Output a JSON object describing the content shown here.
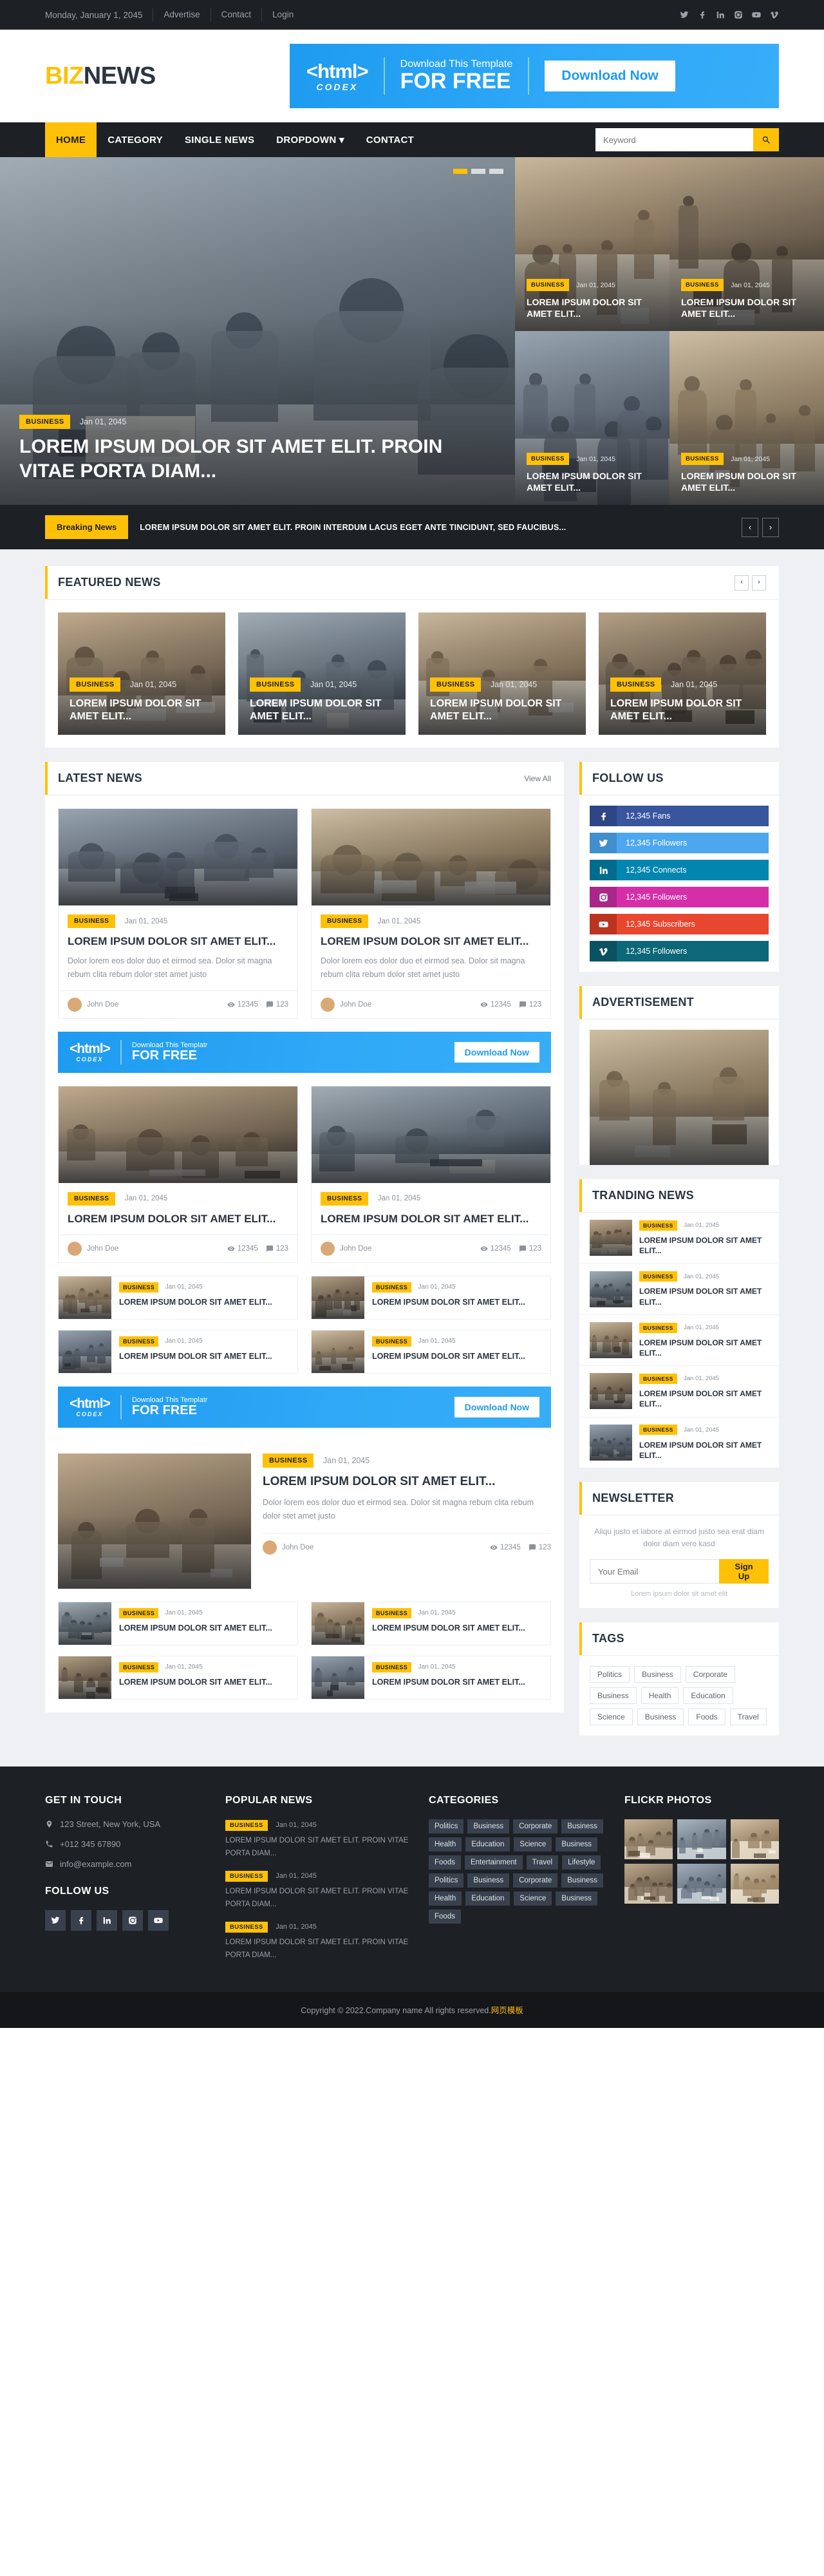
{
  "topbar": {
    "date": "Monday, January 1, 2045",
    "links": [
      "Advertise",
      "Contact",
      "Login"
    ],
    "socials": [
      "twitter-icon",
      "facebook-icon",
      "linkedin-icon",
      "instagram-icon",
      "youtube-icon",
      "vimeo-icon"
    ]
  },
  "header": {
    "logo_first": "BIZ",
    "logo_second": "NEWS",
    "ad": {
      "tag": "<html>",
      "codex": "CODEX",
      "line1": "Download This Template",
      "line2": "FOR FREE",
      "button": "Download Now"
    }
  },
  "nav": {
    "items": [
      {
        "label": "HOME",
        "active": true
      },
      {
        "label": "CATEGORY",
        "active": false
      },
      {
        "label": "SINGLE NEWS",
        "active": false
      },
      {
        "label": "DROPDOWN ▾",
        "active": false
      },
      {
        "label": "CONTACT",
        "active": false
      }
    ],
    "search_placeholder": "Keyword"
  },
  "hero": {
    "main": {
      "category": "BUSINESS",
      "date": "Jan 01, 2045",
      "title": "LOREM IPSUM DOLOR SIT AMET ELIT. PROIN VITAE PORTA DIAM..."
    },
    "side": [
      {
        "category": "BUSINESS",
        "date": "Jan 01, 2045",
        "title": "LOREM IPSUM DOLOR SIT AMET ELIT..."
      },
      {
        "category": "BUSINESS",
        "date": "Jan 01, 2045",
        "title": "LOREM IPSUM DOLOR SIT AMET ELIT..."
      },
      {
        "category": "BUSINESS",
        "date": "Jan 01, 2045",
        "title": "LOREM IPSUM DOLOR SIT AMET ELIT..."
      },
      {
        "category": "BUSINESS",
        "date": "Jan 01, 2045",
        "title": "LOREM IPSUM DOLOR SIT AMET ELIT..."
      }
    ]
  },
  "breaking": {
    "label": "Breaking News",
    "text": "LOREM IPSUM DOLOR SIT AMET ELIT. PROIN INTERDUM LACUS EGET ANTE TINCIDUNT, SED FAUCIBUS...",
    "prev": "‹",
    "next": "›"
  },
  "featured": {
    "title": "FEATURED NEWS",
    "prev": "‹",
    "next": "›",
    "items": [
      {
        "category": "BUSINESS",
        "date": "Jan 01, 2045",
        "title": "LOREM IPSUM DOLOR SIT AMET ELIT..."
      },
      {
        "category": "BUSINESS",
        "date": "Jan 01, 2045",
        "title": "LOREM IPSUM DOLOR SIT AMET ELIT..."
      },
      {
        "category": "BUSINESS",
        "date": "Jan 01, 2045",
        "title": "LOREM IPSUM DOLOR SIT AMET ELIT..."
      },
      {
        "category": "BUSINESS",
        "date": "Jan 01, 2045",
        "title": "LOREM IPSUM DOLOR SIT AMET ELIT..."
      }
    ]
  },
  "latest": {
    "title": "LATEST NEWS",
    "view_all": "View All",
    "cards": [
      {
        "category": "BUSINESS",
        "date": "Jan 01, 2045",
        "title": "LOREM IPSUM DOLOR SIT AMET ELIT...",
        "excerpt": "Dolor lorem eos dolor duo et eirmod sea. Dolor sit magna rebum clita rebum dolor stet amet justo",
        "author": "John Doe",
        "views": "12345",
        "comments": "123"
      },
      {
        "category": "BUSINESS",
        "date": "Jan 01, 2045",
        "title": "LOREM IPSUM DOLOR SIT AMET ELIT...",
        "excerpt": "Dolor lorem eos dolor duo et eirmod sea. Dolor sit magna rebum clita rebum dolor stet amet justo",
        "author": "John Doe",
        "views": "12345",
        "comments": "123"
      },
      {
        "category": "BUSINESS",
        "date": "Jan 01, 2045",
        "title": "LOREM IPSUM DOLOR SIT AMET ELIT...",
        "excerpt": "",
        "author": "John Doe",
        "views": "12345",
        "comments": "123"
      },
      {
        "category": "BUSINESS",
        "date": "Jan 01, 2045",
        "title": "LOREM IPSUM DOLOR SIT AMET ELIT...",
        "excerpt": "",
        "author": "John Doe",
        "views": "12345",
        "comments": "123"
      }
    ],
    "small_items": [
      {
        "category": "BUSINESS",
        "date": "Jan 01, 2045",
        "title": "LOREM IPSUM DOLOR SIT AMET ELIT..."
      },
      {
        "category": "BUSINESS",
        "date": "Jan 01, 2045",
        "title": "LOREM IPSUM DOLOR SIT AMET ELIT..."
      },
      {
        "category": "BUSINESS",
        "date": "Jan 01, 2045",
        "title": "LOREM IPSUM DOLOR SIT AMET ELIT..."
      },
      {
        "category": "BUSINESS",
        "date": "Jan 01, 2045",
        "title": "LOREM IPSUM DOLOR SIT AMET ELIT..."
      }
    ],
    "big_feature": {
      "category": "BUSINESS",
      "date": "Jan 01, 2045",
      "title": "LOREM IPSUM DOLOR SIT AMET ELIT...",
      "excerpt": "Dolor lorem eos dolor duo et eirmod sea. Dolor sit magna rebum clita rebum dolor stet amet justo",
      "author": "John Doe",
      "views": "12345",
      "comments": "123"
    },
    "small_items_2": [
      {
        "category": "BUSINESS",
        "date": "Jan 01, 2045",
        "title": "LOREM IPSUM DOLOR SIT AMET ELIT..."
      },
      {
        "category": "BUSINESS",
        "date": "Jan 01, 2045",
        "title": "LOREM IPSUM DOLOR SIT AMET ELIT..."
      },
      {
        "category": "BUSINESS",
        "date": "Jan 01, 2045",
        "title": "LOREM IPSUM DOLOR SIT AMET ELIT..."
      },
      {
        "category": "BUSINESS",
        "date": "Jan 01, 2045",
        "title": "LOREM IPSUM DOLOR SIT AMET ELIT..."
      }
    ],
    "inner_ad": {
      "tag": "<html>",
      "codex": "CODEX",
      "line1": "Download This Templatr",
      "line2": "FOR FREE",
      "button": "Download Now"
    }
  },
  "sidebar": {
    "follow_us": {
      "title": "FOLLOW US",
      "items": [
        {
          "icon": "facebook-icon",
          "label": "12,345 Fans",
          "color": "#39559E",
          "icon_bg": "#2F4686"
        },
        {
          "icon": "twitter-icon",
          "label": "12,345 Followers",
          "color": "#4DA7EE",
          "icon_bg": "#418FCC"
        },
        {
          "icon": "linkedin-icon",
          "label": "12,345 Connects",
          "color": "#0285AE",
          "icon_bg": "#016C8D"
        },
        {
          "icon": "instagram-icon",
          "label": "12,345 Followers",
          "color": "#D62EA8",
          "icon_bg": "#A92789"
        },
        {
          "icon": "youtube-icon",
          "label": "12,345 Subscribers",
          "color": "#E8462E",
          "icon_bg": "#BB3420"
        },
        {
          "icon": "vimeo-icon",
          "label": "12,345 Followers",
          "color": "#0C6779",
          "icon_bg": "#0A5260"
        }
      ]
    },
    "advertisement": {
      "title": "ADVERTISEMENT"
    },
    "trending": {
      "title": "TRANDING NEWS",
      "items": [
        {
          "category": "BUSINESS",
          "date": "Jan 01, 2045",
          "title": "LOREM IPSUM DOLOR SIT AMET ELIT..."
        },
        {
          "category": "BUSINESS",
          "date": "Jan 01, 2045",
          "title": "LOREM IPSUM DOLOR SIT AMET ELIT..."
        },
        {
          "category": "BUSINESS",
          "date": "Jan 01, 2045",
          "title": "LOREM IPSUM DOLOR SIT AMET ELIT..."
        },
        {
          "category": "BUSINESS",
          "date": "Jan 01, 2045",
          "title": "LOREM IPSUM DOLOR SIT AMET ELIT..."
        },
        {
          "category": "BUSINESS",
          "date": "Jan 01, 2045",
          "title": "LOREM IPSUM DOLOR SIT AMET ELIT..."
        }
      ]
    },
    "newsletter": {
      "title": "NEWSLETTER",
      "description": "Aliqu justo et labore at eirmod justo sea erat diam dolor diam vero kasd",
      "email_placeholder": "Your Email",
      "button": "Sign Up",
      "note": "Lorem ipsum dolor sit amet elit"
    },
    "tags": {
      "title": "TAGS",
      "items": [
        "Politics",
        "Business",
        "Corporate",
        "Business",
        "Health",
        "Education",
        "Science",
        "Business",
        "Foods",
        "Travel"
      ]
    }
  },
  "footer": {
    "get_in_touch": {
      "title": "GET IN TOUCH",
      "address": "123 Street, New York, USA",
      "phone": "+012 345 67890",
      "email": "info@example.com"
    },
    "follow_us": {
      "title": "FOLLOW US",
      "icons": [
        "twitter-icon",
        "facebook-icon",
        "linkedin-icon",
        "instagram-icon",
        "youtube-icon"
      ]
    },
    "popular_news": {
      "title": "POPULAR NEWS",
      "items": [
        {
          "category": "BUSINESS",
          "date": "Jan 01, 2045",
          "text": "LOREM IPSUM DOLOR SIT AMET ELIT. PROIN VITAE PORTA DIAM..."
        },
        {
          "category": "BUSINESS",
          "date": "Jan 01, 2045",
          "text": "LOREM IPSUM DOLOR SIT AMET ELIT. PROIN VITAE PORTA DIAM..."
        },
        {
          "category": "BUSINESS",
          "date": "Jan 01, 2045",
          "text": "LOREM IPSUM DOLOR SIT AMET ELIT. PROIN VITAE PORTA DIAM..."
        }
      ]
    },
    "categories": {
      "title": "CATEGORIES",
      "items": [
        "Politics",
        "Business",
        "Corporate",
        "Business",
        "Health",
        "Education",
        "Science",
        "Business",
        "Foods",
        "Entertainment",
        "Travel",
        "Lifestyle",
        "Politics",
        "Business",
        "Corporate",
        "Business",
        "Health",
        "Education",
        "Science",
        "Business",
        "Foods"
      ]
    },
    "flickr": {
      "title": "FLICKR PHOTOS",
      "count": 6
    },
    "copyright": "Copyright © 2022.Company name All rights reserved.",
    "copyright_link": "网页模板"
  }
}
